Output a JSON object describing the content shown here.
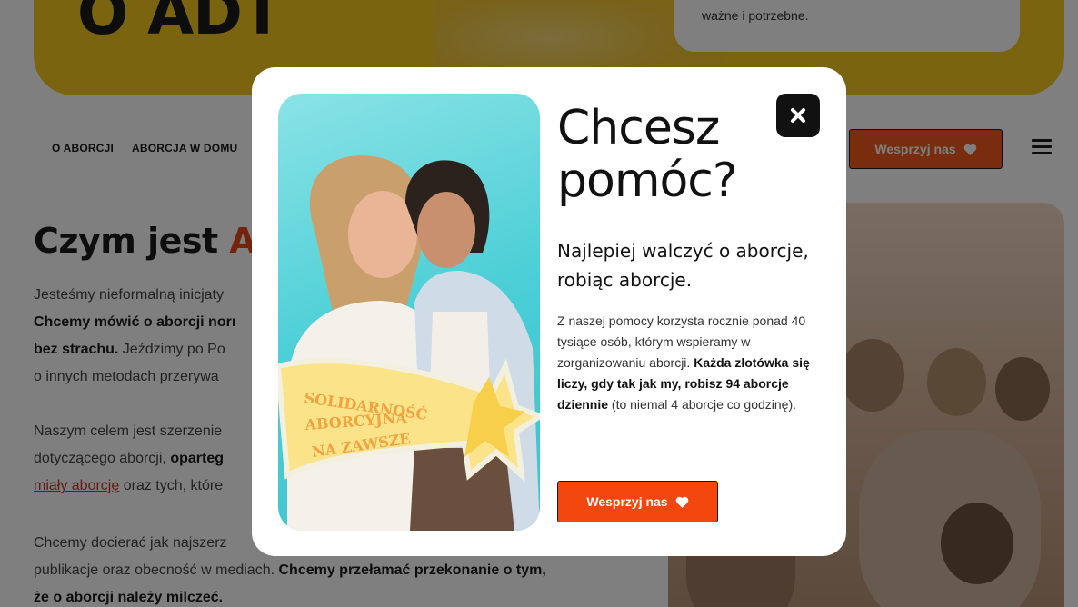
{
  "hero": {
    "title": "O ADT",
    "card_text": "ważne i potrzebne."
  },
  "nav": {
    "items": [
      "O ABORCJI",
      "ABORCJA W DOMU"
    ],
    "cta_label": "Wesprzyj nas"
  },
  "section": {
    "title_prefix": "Czym jest ",
    "title_accent": "AD",
    "paragraphs": {
      "p1_l1": "Jesteśmy nieformalną inicjaty",
      "p1_l2": "Chcemy mówić o aborcji norı",
      "p1_l3a": "bez strachu.",
      "p1_l3b": " Jeździmy po Po",
      "p1_l4": "o innych metodach przerywa",
      "p2_l1": "Naszym celem jest szerzenie",
      "p2_l2a": "dotyczącego aborcji, ",
      "p2_l2b": "oparteg",
      "p2_l3a": "miały aborcję",
      "p2_l3b": " oraz tych, które",
      "p3_l1": "Chcemy docierać jak najszerz",
      "p3_l2a": "publikacje oraz obecność w mediach. ",
      "p3_l2b": "Chcemy przełamać przekonanie o tym,",
      "p3_l3": "że o aborcji należy milczeć."
    }
  },
  "modal": {
    "title": "Chcesz pomóc?",
    "subtitle": "Najlepiej walczyć o aborcje, robiąc aborcje.",
    "body_normal_1": "Z naszej pomocy korzysta rocznie ponad 40 tysiące osób, którym wspieramy w zorganizowaniu aborcji. ",
    "body_bold": "Każda złotówka się liczy, gdy tak jak my, robisz 94 aborcje dziennie",
    "body_normal_2": " (to niemal 4 aborcje co godzinę).",
    "cta_label": "Wesprzyj nas",
    "sign_lines": [
      "SOLIDARNOŚĆ",
      "ABORCYJNA",
      "NA ZAWSZE"
    ]
  },
  "icons": {
    "close": "close-icon",
    "heart": "heart-icon",
    "menu": "hamburger-menu-icon"
  },
  "colors": {
    "brand_yellow": "#f7c81e",
    "brand_orange": "#f4470f",
    "accent_red": "#e8461a",
    "modal_teal": "#4ccfd6"
  }
}
